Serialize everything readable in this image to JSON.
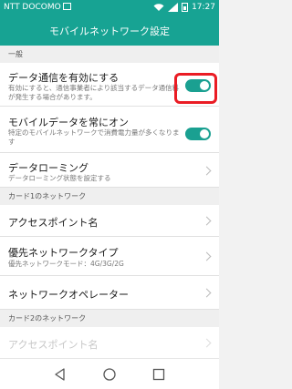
{
  "status_bar": {
    "carrier": "NTT DOCOMO",
    "time": "17:27",
    "icons": [
      "wifi-icon",
      "signal-icon",
      "battery-icon"
    ]
  },
  "header": {
    "title": "モバイルネットワーク設定"
  },
  "sections": [
    {
      "label": "一般",
      "items": [
        {
          "title": "データ通信を有効にする",
          "subtitle": "有効にすると、通信事業者により該当するデータ通信料が発生する場合があります。",
          "control": "toggle",
          "toggle_on": true
        },
        {
          "title": "モバイルデータを常にオン",
          "subtitle": "特定のモバイルネットワークで消費電力量が多くなります",
          "control": "toggle",
          "toggle_on": true
        },
        {
          "title": "データローミング",
          "subtitle": "データローミング状態を設定する",
          "control": "chevron"
        }
      ]
    },
    {
      "label": "カード1のネットワーク",
      "items": [
        {
          "title": "アクセスポイント名",
          "control": "chevron"
        },
        {
          "title": "優先ネットワークタイプ",
          "subtitle": "優先ネットワークモード：4G/3G/2G",
          "control": "chevron"
        },
        {
          "title": "ネットワークオペレーター",
          "control": "chevron"
        }
      ]
    },
    {
      "label": "カード2のネットワーク",
      "items": [
        {
          "title": "アクセスポイント名",
          "control": "chevron",
          "disabled": true
        }
      ]
    }
  ],
  "colors": {
    "accent": "#17a393",
    "toggle_on": "#1aa091",
    "highlight": "#ea1c24"
  },
  "navbar": {
    "buttons": [
      "back-icon",
      "home-icon",
      "recent-apps-icon"
    ]
  }
}
